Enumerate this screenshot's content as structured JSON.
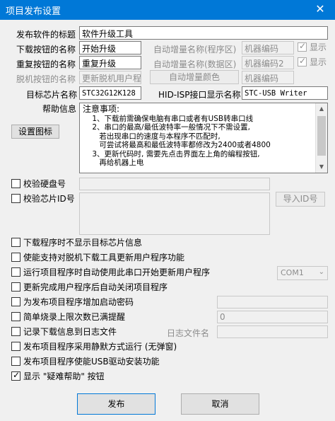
{
  "window": {
    "title": "项目发布设置",
    "close": "✕"
  },
  "fields": {
    "publish_title_label": "发布软件的标题",
    "publish_title_value": "软件升级工具",
    "download_label": "下载按钮的名称",
    "download_value": "开始升级",
    "redownload_label": "重复按钮的名称",
    "redownload_value": "重复升级",
    "offline_label": "脱机按钮的名称",
    "offline_value": "更新脱机用户程",
    "auto_inc_program_label": "自动增量名称(程序区)",
    "auto_inc_program_value": "机器编码",
    "auto_inc_data_label": "自动增量名称(数据区)",
    "auto_inc_data_value": "机器编码2",
    "auto_inc_color_button": "自动增量颜色",
    "auto_inc_extra_value": "机器编码",
    "show_label_1": "显示",
    "show_label_2": "显示",
    "target_chip_label": "目标芯片名称",
    "target_chip_value": "STC32G12K128",
    "hid_label": "HID-ISP接口显示名称",
    "hid_value": "STC-USB Writer",
    "help_label": "帮助信息",
    "set_icon_button": "设置图标"
  },
  "help_text": {
    "heading": "注意事项:",
    "lines": [
      "    1、下载前需确保电脑有串口或者有USB转串口线",
      "    2、串口的最高/最低波特率一般情况下不需设置,",
      "       若出现串口的速度与本程序不匹配时,",
      "       可尝试将最高和最低波特率都修改为2400或者4800",
      "    3、更新代码时, 需要先点击界面左上角的编程按钮,",
      "       再给机器上电"
    ]
  },
  "verify": {
    "disk_label": "校验硬盘号",
    "chip_id_label": "校验芯片ID号",
    "import_id_button": "导入ID号"
  },
  "options": [
    {
      "label": "下载程序时不显示目标芯片信息",
      "checked": false
    },
    {
      "label": "使能支持对脱机下载工具更新用户程序功能",
      "checked": false
    },
    {
      "label": "运行项目程序时自动使用此串口开始更新用户程序",
      "checked": false
    },
    {
      "label": "更新完成用户程序后自动关闭项目程序",
      "checked": false
    },
    {
      "label": "为发布项目程序增加启动密码",
      "checked": false
    },
    {
      "label": "简单烧录上限次数已满提醒",
      "checked": false
    },
    {
      "label": "记录下载信息到日志文件",
      "checked": false
    },
    {
      "label": "发布项目程序采用静默方式运行 (无弹窗)",
      "checked": false
    },
    {
      "label": "发布项目程序使能USB驱动安装功能",
      "checked": false
    },
    {
      "label": "显示 \"疑难帮助\" 按钮",
      "checked": true
    }
  ],
  "com_select": {
    "value": "COM1",
    "arrow": "⌄"
  },
  "burn_limit_value": "0",
  "log_file_label": "日志文件名",
  "footer": {
    "publish_button": "发布",
    "cancel_button": "取消"
  }
}
